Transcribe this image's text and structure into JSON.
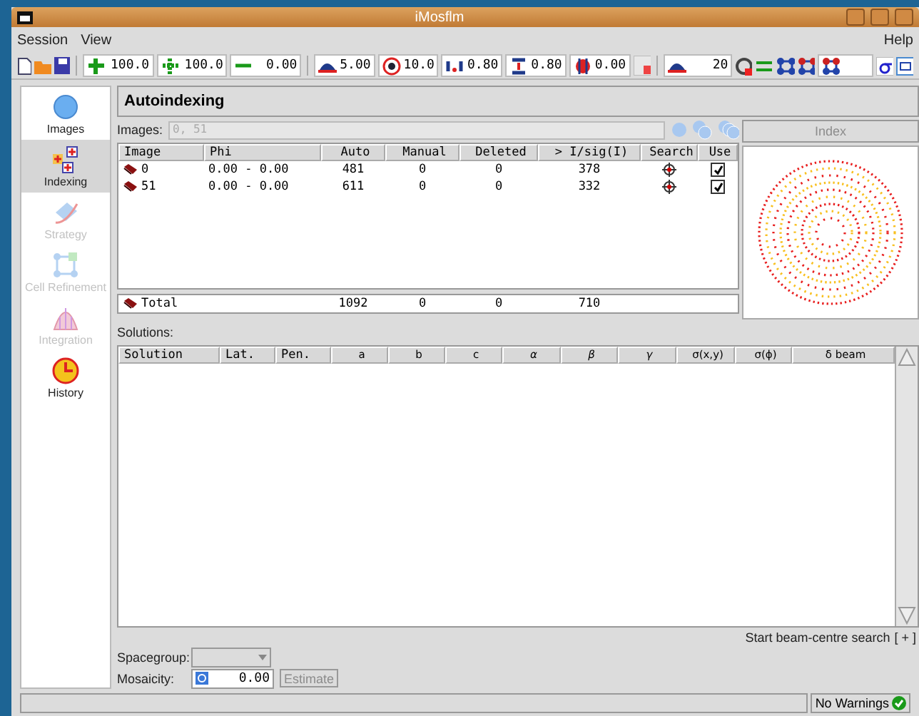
{
  "window": {
    "title": "iMosflm"
  },
  "menu": [
    {
      "label": "Session"
    },
    {
      "label": "View"
    },
    {
      "label": "Help"
    }
  ],
  "toolbar": {
    "fields": [
      {
        "value": "100.0"
      },
      {
        "value": "100.0"
      },
      {
        "value": "0.00"
      },
      {
        "value": "5.00"
      },
      {
        "value": "10.0"
      },
      {
        "value": "0.80"
      },
      {
        "value": "0.80"
      },
      {
        "value": "0.00"
      }
    ],
    "threshold": {
      "value": "20"
    }
  },
  "sidebar": {
    "items": [
      {
        "label": "Images",
        "selected": false,
        "disabled": false
      },
      {
        "label": "Indexing",
        "selected": true,
        "disabled": false
      },
      {
        "label": "Strategy",
        "selected": false,
        "disabled": true
      },
      {
        "label": "Cell Refinement",
        "selected": false,
        "disabled": true
      },
      {
        "label": "Integration",
        "selected": false,
        "disabled": true
      },
      {
        "label": "History",
        "selected": false,
        "disabled": false
      }
    ]
  },
  "panel": {
    "title": "Autoindexing",
    "images_label": "Images:",
    "images_value": "0, 51",
    "index_button": "Index"
  },
  "table": {
    "columns": [
      "Image",
      "Phi",
      "Auto",
      "Manual",
      "Deleted",
      "> I/sig(I)",
      "Search",
      "Use"
    ],
    "rows": [
      {
        "image": "0",
        "phi": "0.00 - 0.00",
        "auto": "481",
        "manual": "0",
        "deleted": "0",
        "isig": "378",
        "use": true
      },
      {
        "image": "51",
        "phi": "0.00 - 0.00",
        "auto": "611",
        "manual": "0",
        "deleted": "0",
        "isig": "332",
        "use": true
      }
    ],
    "total": {
      "label": "Total",
      "auto": "1092",
      "manual": "0",
      "deleted": "0",
      "isig": "710"
    }
  },
  "solutions": {
    "label": "Solutions:",
    "columns": [
      "Solution",
      "Lat.",
      "Pen.",
      "a",
      "b",
      "c",
      "α",
      "β",
      "γ",
      "σ(x,y)",
      "σ(ϕ)",
      "δ beam"
    ]
  },
  "beam_search": {
    "label": "Start beam-centre search",
    "button": "[ + ]"
  },
  "spacegroup": {
    "label": "Spacegroup:"
  },
  "mosaicity": {
    "label": "Mosaicity:",
    "value": "0.00",
    "button": "Estimate"
  },
  "status_bar": {
    "warnings": "No Warnings"
  }
}
